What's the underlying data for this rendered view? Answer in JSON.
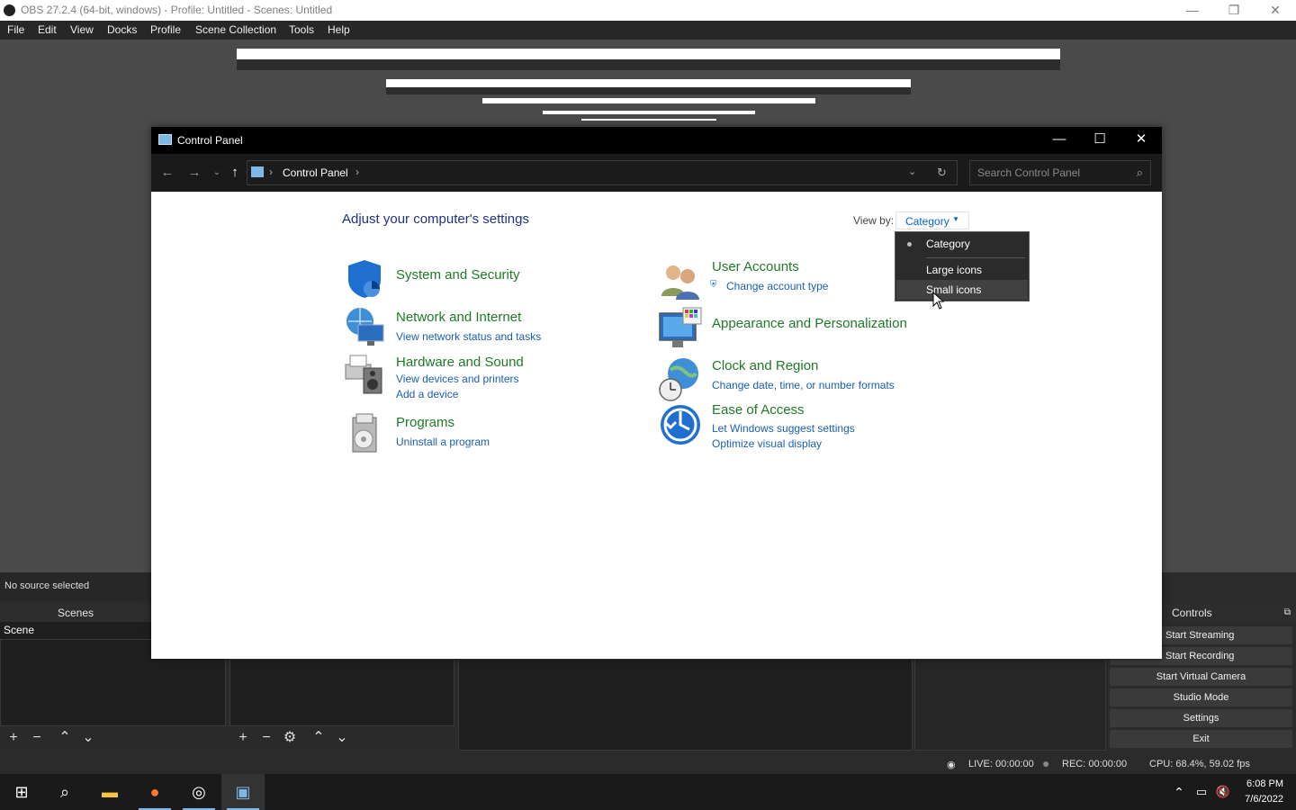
{
  "obs": {
    "title": "OBS 27.2.4 (64-bit, windows) - Profile: Untitled - Scenes: Untitled",
    "menu": [
      "File",
      "Edit",
      "View",
      "Docks",
      "Profile",
      "Scene Collection",
      "Tools",
      "Help"
    ],
    "no_source": "No source selected",
    "scenes_header": "Scenes",
    "scene_item": "Scene",
    "controls_header": "Controls",
    "controls": [
      "Start Streaming",
      "Start Recording",
      "Start Virtual Camera",
      "Studio Mode",
      "Settings",
      "Exit"
    ],
    "status": {
      "live": "LIVE: 00:00:00",
      "rec": "REC: 00:00:00",
      "cpu": "CPU: 68.4%, 59.02 fps"
    }
  },
  "control_panel": {
    "title": "Control Panel",
    "breadcrumb": "Control Panel",
    "search_placeholder": "Search Control Panel",
    "adjust_title": "Adjust your computer's settings",
    "view_by_label": "View by:",
    "view_by_value": "Category",
    "view_by_options": [
      "Category",
      "Large icons",
      "Small icons"
    ],
    "categories": [
      {
        "title": "System and Security",
        "links": []
      },
      {
        "title": "Network and Internet",
        "links": [
          "View network status and tasks"
        ]
      },
      {
        "title": "Hardware and Sound",
        "links": [
          "View devices and printers",
          "Add a device"
        ]
      },
      {
        "title": "Programs",
        "links": [
          "Uninstall a program"
        ]
      },
      {
        "title": "User Accounts",
        "links": [
          "Change account type"
        ]
      },
      {
        "title": "Appearance and Personalization",
        "links": []
      },
      {
        "title": "Clock and Region",
        "links": [
          "Change date, time, or number formats"
        ]
      },
      {
        "title": "Ease of Access",
        "links": [
          "Let Windows suggest settings",
          "Optimize visual display"
        ]
      }
    ]
  },
  "taskbar": {
    "time": "6:08 PM",
    "date": "7/6/2022"
  },
  "icons": {
    "back": "arrow-left-icon",
    "forward": "arrow-right-icon",
    "up": "arrow-up-icon",
    "refresh": "refresh-icon",
    "search": "search-icon"
  }
}
